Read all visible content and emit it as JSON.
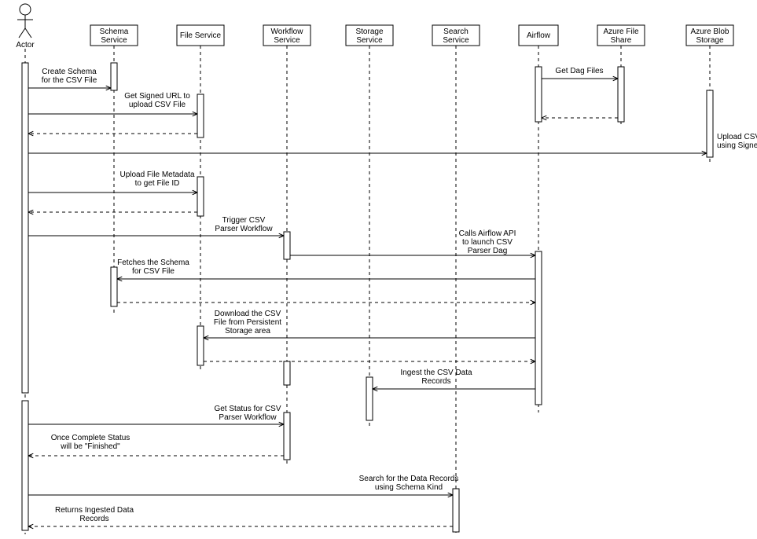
{
  "participants": {
    "actor": "Actor",
    "schema": "Schema Service",
    "file": "File Service",
    "workflow": "Workflow Service",
    "storage": "Storage Service",
    "search": "Search Service",
    "airflow": "Airflow",
    "azfile": "Azure File Share",
    "azblob": "Azure Blob Storage"
  },
  "messages": {
    "m1": "Create Schema for the CSV File",
    "m2": "Get Signed URL to upload CSV File",
    "m3": "Get Dag Files",
    "m4": "Upload CSV File using Signed URL",
    "m5": "Upload File Metadata to get File ID",
    "m6": "Trigger CSV Parser Workflow",
    "m7": "Calls Airflow API to launch CSV Parser Dag",
    "m8": "Fetches the Schema for CSV File",
    "m9": "Download the CSV File from Persistent Storage area",
    "m10": "Ingest the CSV Data Records",
    "m11": "Get Status for CSV Parser Workflow",
    "m12": "Once Complete Status will be \"Finished\"",
    "m13": "Search for the Data Records using Schema Kind",
    "m14": "Returns Ingested Data Records"
  }
}
